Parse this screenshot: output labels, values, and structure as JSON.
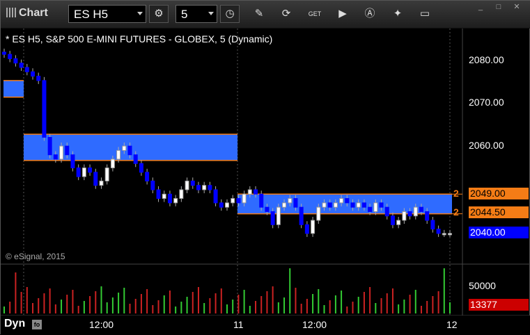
{
  "window": {
    "title": "Chart"
  },
  "toolbar": {
    "symbol": "ES H5",
    "interval": "5",
    "buttons": [
      {
        "name": "pencil-icon",
        "glyph": "✎"
      },
      {
        "name": "refresh-icon",
        "glyph": "⟳"
      },
      {
        "name": "get-icon",
        "glyph": "GET"
      },
      {
        "name": "play-icon",
        "glyph": "▶"
      },
      {
        "name": "alert-icon",
        "glyph": "Ⓐ"
      },
      {
        "name": "tools-icon",
        "glyph": "✦"
      },
      {
        "name": "comment-icon",
        "glyph": "▭"
      }
    ]
  },
  "chart": {
    "title": "* ES H5, S&P 500 E-MINI FUTURES - GLOBEX, 5 (Dynamic)",
    "copyright": "© eSignal, 2015",
    "price_ticks": [
      "2080.00",
      "2070.00",
      "2060.00",
      "2040.00"
    ],
    "price_tags": [
      {
        "label": "2049.00",
        "marker": "2",
        "style": "orange"
      },
      {
        "label": "2044.50",
        "marker": "2",
        "style": "orange"
      },
      {
        "label": "2040.00",
        "marker": "",
        "style": "blue"
      }
    ],
    "volume_tick": "50000",
    "volume_tag": "13377",
    "x_ticks": [
      "12:00",
      "11",
      "12:00",
      "12"
    ],
    "dyn_label": "Dyn",
    "colors": {
      "zone": "#2f6bff",
      "zone_border": "#f47c16",
      "up": "#ffffff",
      "down": "#0000ff"
    }
  },
  "chart_data": {
    "type": "candlestick",
    "title": "* ES H5, S&P 500 E-MINI FUTURES - GLOBEX, 5 (Dynamic)",
    "ylim": [
      2036,
      2085
    ],
    "zones": [
      {
        "from": 2071.2,
        "to": 2075.0
      },
      {
        "from": 2056.7,
        "to": 2062.7
      },
      {
        "from": 2044.5,
        "to": 2049.0
      }
    ],
    "closes": [
      2081,
      2080,
      2079,
      2078,
      2077,
      2076,
      2075,
      2062,
      2058,
      2057,
      2060,
      2058,
      2055,
      2053,
      2055,
      2054,
      2051,
      2052,
      2055,
      2057,
      2059,
      2060,
      2058,
      2056,
      2054,
      2052,
      2050,
      2048,
      2049,
      2047,
      2048,
      2050,
      2052,
      2051,
      2050,
      2051,
      2050,
      2047,
      2046,
      2047,
      2048,
      2047,
      2049,
      2050,
      2049,
      2046,
      2045,
      2042,
      2046,
      2047,
      2048,
      2046,
      2042,
      2040,
      2043,
      2046,
      2047,
      2046,
      2047,
      2048,
      2047,
      2046,
      2047,
      2046,
      2045,
      2047,
      2046,
      2044,
      2042,
      2043,
      2045,
      2044,
      2046,
      2045,
      2043,
      2041,
      2040,
      2040,
      2040
    ],
    "volume_ticks": [
      "50000"
    ],
    "last_volume": "13377"
  }
}
